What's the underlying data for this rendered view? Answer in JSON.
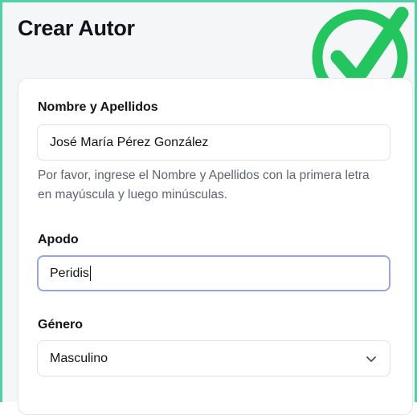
{
  "page": {
    "title": "Crear Autor"
  },
  "form": {
    "name_field": {
      "label": "Nombre y Apellidos",
      "value": "José María Pérez González",
      "help": "Por favor, ingrese el Nombre y Apellidos con la primera letra en mayúscula y luego minúsculas."
    },
    "nickname_field": {
      "label": "Apodo",
      "value": "Peridis"
    },
    "gender_field": {
      "label": "Género",
      "selected": "Masculino"
    }
  },
  "colors": {
    "frame_border": "#4fd1a5",
    "check_badge": "#22c55e",
    "focus_border": "#9aa6da"
  },
  "icons": {
    "badge": "check-circle-icon",
    "select": "chevron-down-icon"
  }
}
